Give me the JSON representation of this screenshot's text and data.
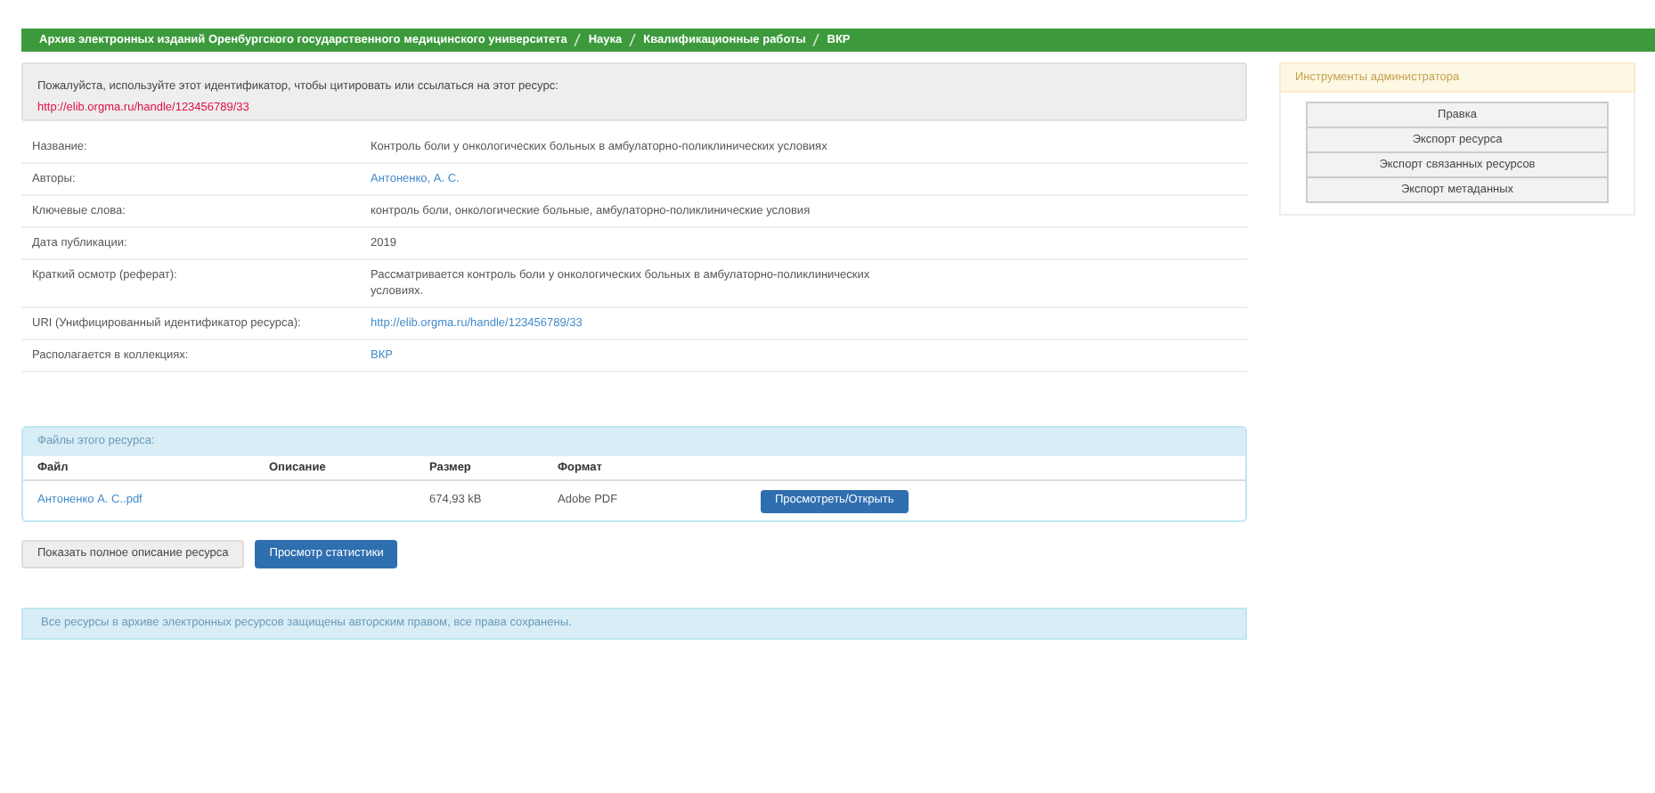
{
  "breadcrumbs": [
    "Архив электронных изданий Оренбургского государственного медицинского университета",
    "Наука",
    "Квалификационные работы",
    "ВКР"
  ],
  "citation_notice": {
    "text": "Пожалуйста, используйте этот идентификатор, чтобы цитировать или ссылаться на этот ресурс:",
    "url": "http://elib.orgma.ru/handle/123456789/33"
  },
  "metadata": [
    {
      "label": "Название:",
      "value": "Контроль боли у онкологических больных в амбулаторно-поликлинических условиях",
      "kind": "text"
    },
    {
      "label": "Авторы:",
      "value": "Антоненко, А. С.",
      "kind": "link"
    },
    {
      "label": "Ключевые слова:",
      "value": "контроль боли, онкологические больные, амбулаторно-поликлинические условия",
      "kind": "text"
    },
    {
      "label": "Дата публикации:",
      "value": "2019",
      "kind": "text"
    },
    {
      "label": "Краткий осмотр (реферат):",
      "value": "Рассматривается контроль боли у онкологических больных в амбулаторно-поликлинических условиях.",
      "kind": "text"
    },
    {
      "label": "URI (Унифицированный идентификатор ресурса):",
      "value": "http://elib.orgma.ru/handle/123456789/33",
      "kind": "link"
    },
    {
      "label": "Располагается в коллекциях:",
      "value": "ВКР",
      "kind": "link"
    }
  ],
  "files": {
    "title": "Файлы этого ресурса:",
    "columns": [
      "Файл",
      "Описание",
      "Размер",
      "Формат"
    ],
    "rows": [
      {
        "file": "Антоненко А. С..pdf",
        "size": "674,93 kB",
        "format": "Adobe PDF",
        "button": "Просмотреть/Открыть"
      }
    ]
  },
  "buttons": [
    {
      "label": "Показать полное описание ресурса",
      "kind": "default"
    },
    {
      "label": "Просмотр статистики",
      "kind": "primary"
    }
  ],
  "footer_notice": "Все ресурсы в архиве электронных ресурсов защищены авторским правом, все права сохранены.",
  "sidebar": {
    "title": "Инструменты администратора",
    "buttons": [
      "Правка",
      "Экспорт ресурса",
      "Экспорт связанных ресурсов",
      "Экспорт метаданных"
    ]
  }
}
